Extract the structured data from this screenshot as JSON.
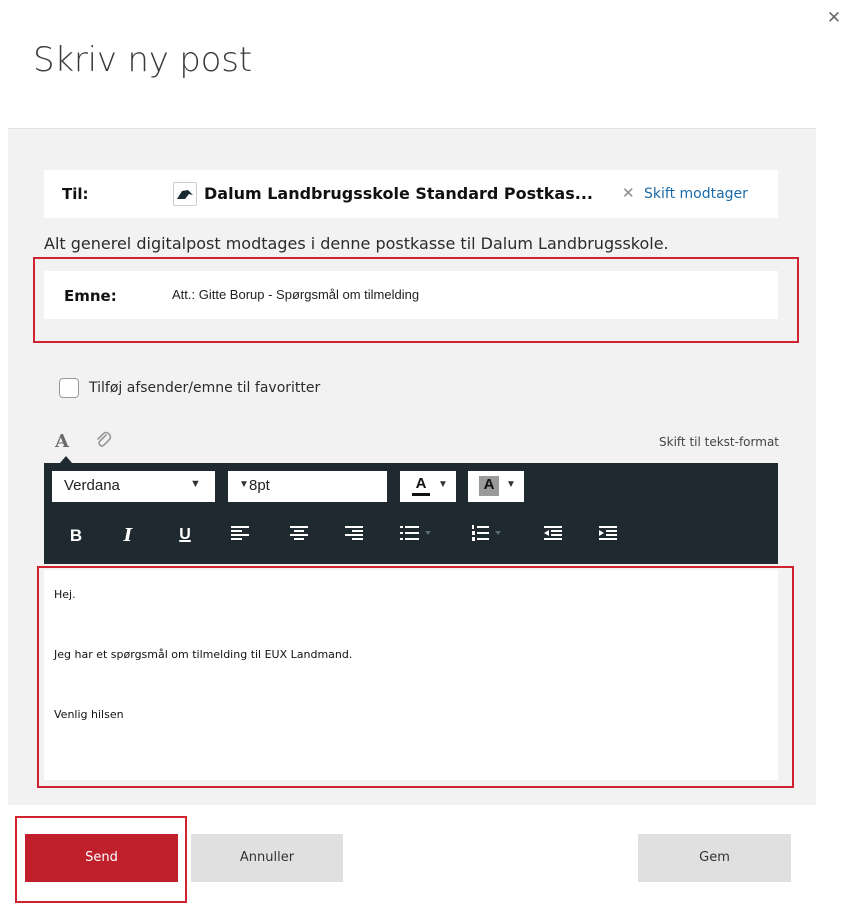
{
  "dialog": {
    "title": "Skriv ny post",
    "close_icon": "close-icon"
  },
  "recipient": {
    "label": "Til:",
    "name": "Dalum Landbrugsskole Standard Postkas...",
    "change_icon": "x-icon",
    "change_label": "Skift modtager",
    "icon": "organization-logo-icon"
  },
  "info_text": "Alt generel digitalpost modtages i denne postkasse til Dalum Landbrugsskole.",
  "subject": {
    "label": "Emne:",
    "value": "Att.: Gitte Borup - Spørgsmål om tilmelding"
  },
  "favorites": {
    "label": "Tilføj afsender/emne til favoritter",
    "checked": false
  },
  "editor_tabs": {
    "format_icon": "text-format-icon",
    "attach_icon": "paperclip-icon",
    "switch_label": "Skift til tekst-format"
  },
  "toolbar": {
    "font": "Verdana",
    "size": "8pt",
    "font_color_letter": "A",
    "bg_color_letter": "A",
    "buttons": [
      {
        "name": "bold",
        "label": "B"
      },
      {
        "name": "italic",
        "label": "I"
      },
      {
        "name": "underline",
        "label": "U"
      },
      {
        "name": "align-left",
        "icon": "align-left-icon"
      },
      {
        "name": "align-center",
        "icon": "align-center-icon"
      },
      {
        "name": "align-right",
        "icon": "align-right-icon"
      },
      {
        "name": "bullet-list",
        "icon": "bullet-list-icon"
      },
      {
        "name": "numbered-list",
        "icon": "numbered-list-icon"
      },
      {
        "name": "outdent",
        "icon": "outdent-icon"
      },
      {
        "name": "indent",
        "icon": "indent-icon"
      }
    ]
  },
  "body": {
    "lines": [
      "Hej.",
      "Jeg har et spørgsmål om tilmelding til EUX Landmand.",
      "Venlig hilsen"
    ]
  },
  "actions": {
    "send": "Send",
    "cancel": "Annuller",
    "save": "Gem"
  },
  "colors": {
    "primary": "#c0202b",
    "highlight_frame": "#d1232f",
    "toolbar_bg": "#1e2a30",
    "link": "#1a6aa8"
  }
}
